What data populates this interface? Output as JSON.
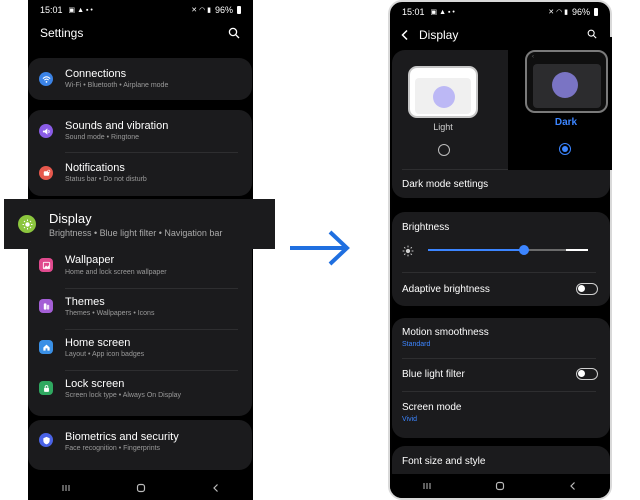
{
  "left_phone": {
    "status": {
      "time": "15:01",
      "battery": "96%"
    },
    "title": "Settings",
    "items": [
      {
        "label": "Connections",
        "sub": "Wi-Fi  •  Bluetooth  •  Airplane mode",
        "color": "#3b83e6",
        "icon": "wifi-icon"
      },
      {
        "label": "Sounds and vibration",
        "sub": "Sound mode  •  Ringtone",
        "color": "#8a5ce6",
        "icon": "volume-icon"
      },
      {
        "label": "Notifications",
        "sub": "Status bar  •  Do not disturb",
        "color": "#e6584d",
        "icon": "bell-icon"
      },
      {
        "label": "Wallpaper",
        "sub": "Home and lock screen wallpaper",
        "color": "#e04a8e",
        "icon": "image-icon"
      },
      {
        "label": "Themes",
        "sub": "Themes  •  Wallpapers  •  Icons",
        "color": "#a45fd6",
        "icon": "palette-icon"
      },
      {
        "label": "Home screen",
        "sub": "Layout  •  App icon badges",
        "color": "#3a90e6",
        "icon": "home-icon"
      },
      {
        "label": "Lock screen",
        "sub": "Screen lock type  •  Always On Display",
        "color": "#2fa860",
        "icon": "lock-icon"
      },
      {
        "label": "Biometrics and security",
        "sub": "Face recognition  •  Fingerprints",
        "color": "#4a63e6",
        "icon": "shield-icon"
      }
    ],
    "highlight": {
      "label": "Display",
      "sub": "Brightness  •  Blue light filter  •  Navigation bar",
      "color": "#8cc63e",
      "icon": "sun-icon"
    }
  },
  "right_phone": {
    "status": {
      "time": "15:01",
      "battery": "96%"
    },
    "title": "Display",
    "light_label": "Light",
    "dark_label": "Dark",
    "dark_mode_settings": "Dark mode settings",
    "brightness_label": "Brightness",
    "brightness_level": 0.6,
    "adaptive_brightness": "Adaptive brightness",
    "motion_smoothness": "Motion smoothness",
    "motion_value": "Standard",
    "blue_light": "Blue light filter",
    "screen_mode": "Screen mode",
    "screen_mode_value": "Vivid",
    "font_size": "Font size and style",
    "accent_color": "#3c85ff"
  },
  "arrow_color": "#1f6fe0"
}
